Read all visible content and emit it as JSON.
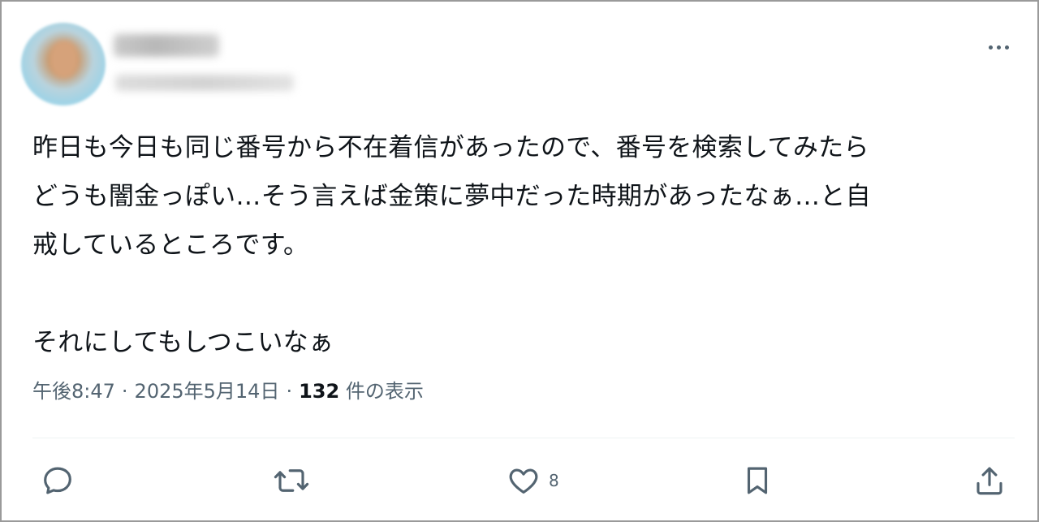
{
  "tweet": {
    "text_lines": [
      "昨日も今日も同じ番号から不在着信があったので、番号を検索してみたら",
      "どうも闇金っぽい…そう言えば金策に夢中だった時期があったなぁ…と自",
      "戒しているところです。"
    ],
    "text_after_break": "それにしてもしつこいなぁ"
  },
  "meta": {
    "time": "午後8:47",
    "separator": "·",
    "date": "2025年5月14日",
    "views_count": "132",
    "views_label": "件の表示"
  },
  "actions": {
    "reply_icon": "reply-icon",
    "retweet_icon": "retweet-icon",
    "like_icon": "heart-icon",
    "like_count": "8",
    "bookmark_icon": "bookmark-icon",
    "share_icon": "share-icon"
  },
  "colors": {
    "text": "#0f1419",
    "secondary": "#536471",
    "divider": "#eff3f4",
    "frame": "#9a9a9a"
  }
}
